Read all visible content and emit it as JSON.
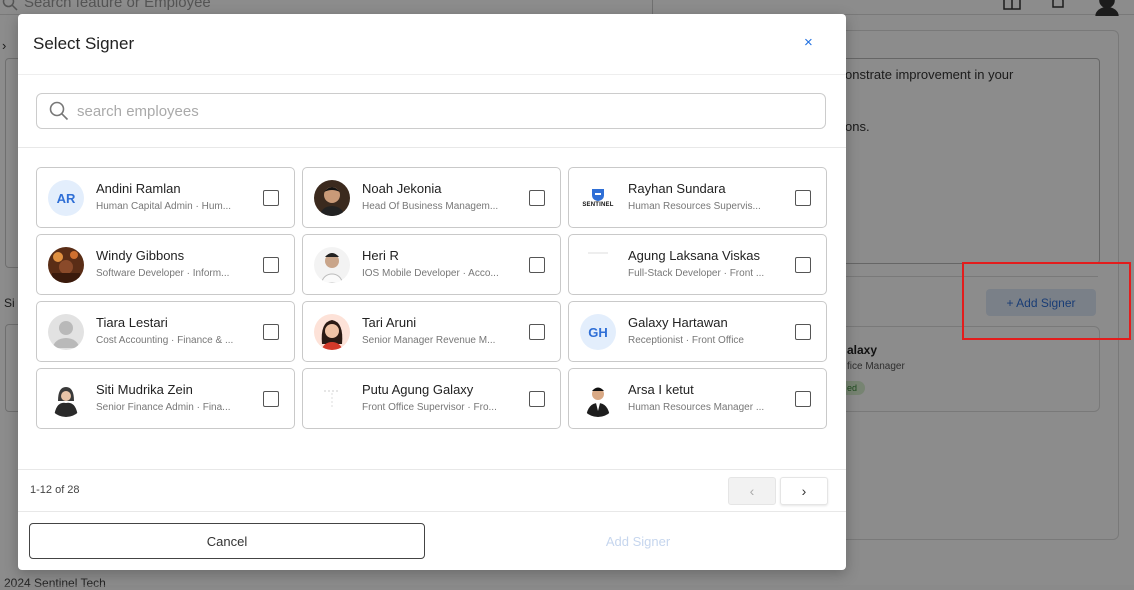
{
  "background": {
    "search_placeholder": "Search feature or Employee",
    "text_line1": "onstrate improvement in your",
    "text_line2": "ons.",
    "section_label": "Si",
    "add_signer_label": "+ Add Signer",
    "signer_name": "alaxy",
    "signer_role": "fice Manager",
    "signer_status": "ed",
    "footer_text": "2024 Sentinel Tech"
  },
  "modal": {
    "title": "Select Signer",
    "close_label": "×",
    "search_placeholder": "search employees",
    "employees": [
      {
        "name": "Andini Ramlan",
        "role": "Human Capital Admin · Hum...",
        "avatar": "initials",
        "initials": "AR"
      },
      {
        "name": "Noah Jekonia",
        "role": "Head Of Business Managem...",
        "avatar": "photo"
      },
      {
        "name": "Rayhan Sundara",
        "role": "Human Resources Supervis...",
        "avatar": "logo-sentinel",
        "logo_text": "SENTINEL"
      },
      {
        "name": "Windy Gibbons",
        "role": "Software Developer · Inform...",
        "avatar": "photo"
      },
      {
        "name": "Heri R",
        "role": "IOS Mobile Developer · Acco...",
        "avatar": "photo"
      },
      {
        "name": "Agung Laksana Viskas",
        "role": "Full-Stack Developer · Front ...",
        "avatar": "blank"
      },
      {
        "name": "Tiara Lestari",
        "role": "Cost Accounting · Finance & ...",
        "avatar": "placeholder-person"
      },
      {
        "name": "Tari Aruni",
        "role": "Senior Manager Revenue M...",
        "avatar": "photo"
      },
      {
        "name": "Galaxy Hartawan",
        "role": "Receptionist · Front Office",
        "avatar": "initials",
        "initials": "GH"
      },
      {
        "name": "Siti Mudrika Zein",
        "role": "Senior Finance Admin · Fina...",
        "avatar": "photo"
      },
      {
        "name": "Putu Agung Galaxy",
        "role": "Front Office Supervisor · Fro...",
        "avatar": "blank"
      },
      {
        "name": "Arsa I ketut",
        "role": "Human Resources Manager ...",
        "avatar": "photo"
      }
    ],
    "pagination": {
      "range": "1-12 of 28",
      "prev": "‹",
      "next": "›"
    },
    "cancel_label": "Cancel",
    "add_label": "Add Signer"
  },
  "colors": {
    "accent": "#1f6fe0",
    "highlight": "#e31c1c"
  }
}
